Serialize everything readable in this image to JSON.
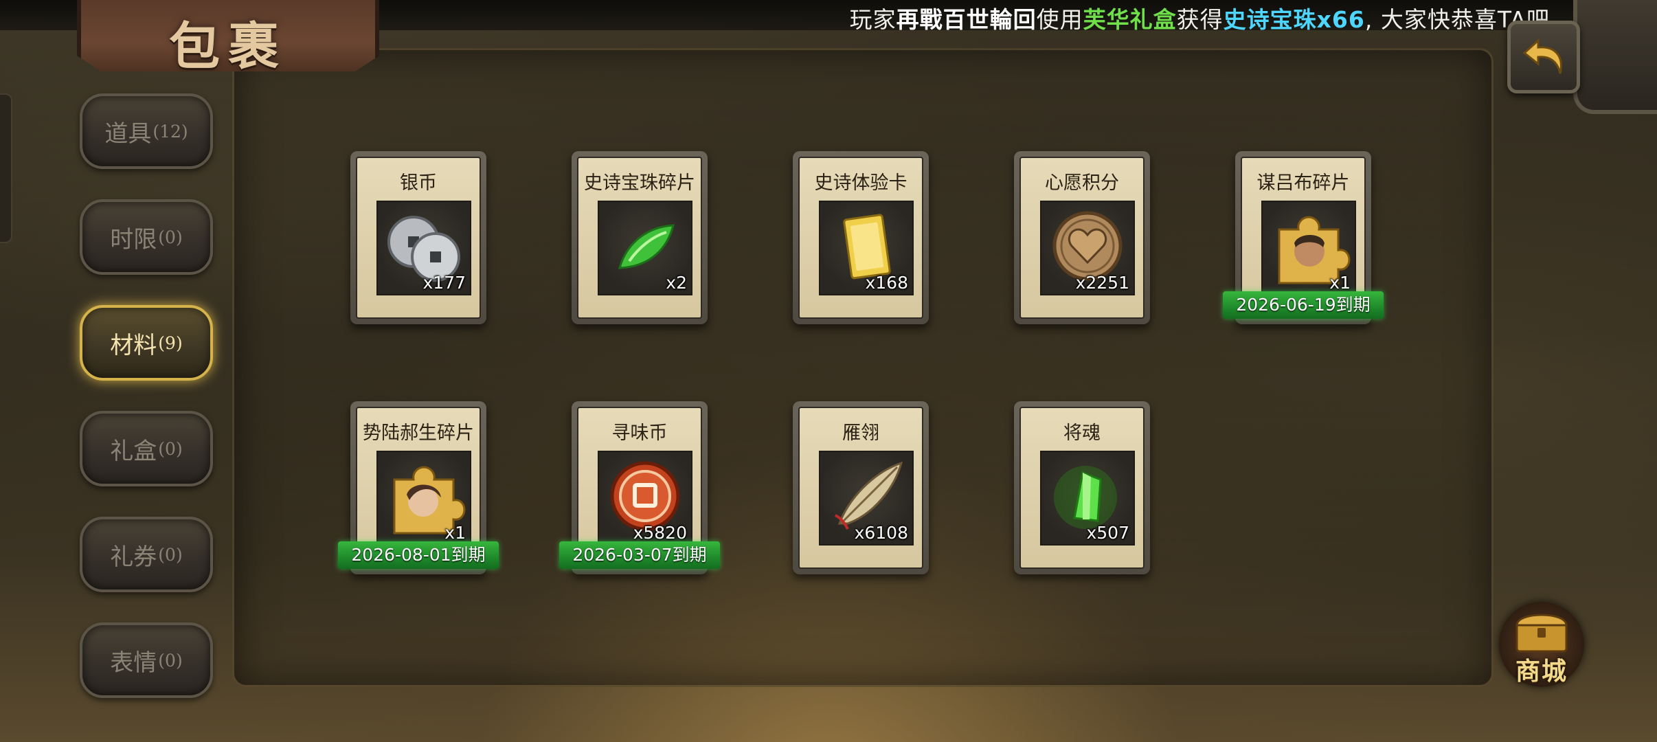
{
  "broadcast": {
    "prefix": "玩家",
    "player_name": "再戰百世輪回",
    "mid": "使用",
    "gift_box": "芙华礼盒",
    "obtained": "获得",
    "reward": "史诗宝珠x66",
    "suffix": ", 大家快恭喜TA吧"
  },
  "header": {
    "title": "包裹"
  },
  "sidebar": {
    "tabs": [
      {
        "label": "道具",
        "count": "(12)"
      },
      {
        "label": "时限",
        "count": "(0)"
      },
      {
        "label": "材料",
        "count": "(9)",
        "active": true
      },
      {
        "label": "礼盒",
        "count": "(0)"
      },
      {
        "label": "礼券",
        "count": "(0)"
      },
      {
        "label": "表情",
        "count": "(0)"
      }
    ]
  },
  "items": [
    {
      "name": "银币",
      "qty": "x177",
      "icon": "silver-coin-icon"
    },
    {
      "name": "史诗宝珠碎片",
      "qty": "x2",
      "icon": "green-gem-shard-icon"
    },
    {
      "name": "史诗体验卡",
      "qty": "x168",
      "icon": "gold-card-icon"
    },
    {
      "name": "心愿积分",
      "qty": "x2251",
      "icon": "heart-coin-icon"
    },
    {
      "name": "谋吕布碎片",
      "qty": "x1",
      "icon": "puzzle-piece-icon",
      "expiry": "2026-06-19到期"
    },
    {
      "name": "势陆郝生碎片",
      "qty": "x1",
      "icon": "puzzle-piece-icon",
      "expiry": "2026-08-01到期"
    },
    {
      "name": "寻味币",
      "qty": "x5820",
      "icon": "red-flavor-coin-icon",
      "expiry": "2026-03-07到期"
    },
    {
      "name": "雁翎",
      "qty": "x6108",
      "icon": "feather-icon"
    },
    {
      "name": "将魂",
      "qty": "x507",
      "icon": "green-crystal-icon"
    }
  ],
  "shop": {
    "label": "商城"
  },
  "colors": {
    "accent_gold": "#d6b24a",
    "expiry_green": "#1f8a2b",
    "broadcast_green": "#6fe04a",
    "broadcast_cyan": "#4fd6ff"
  }
}
